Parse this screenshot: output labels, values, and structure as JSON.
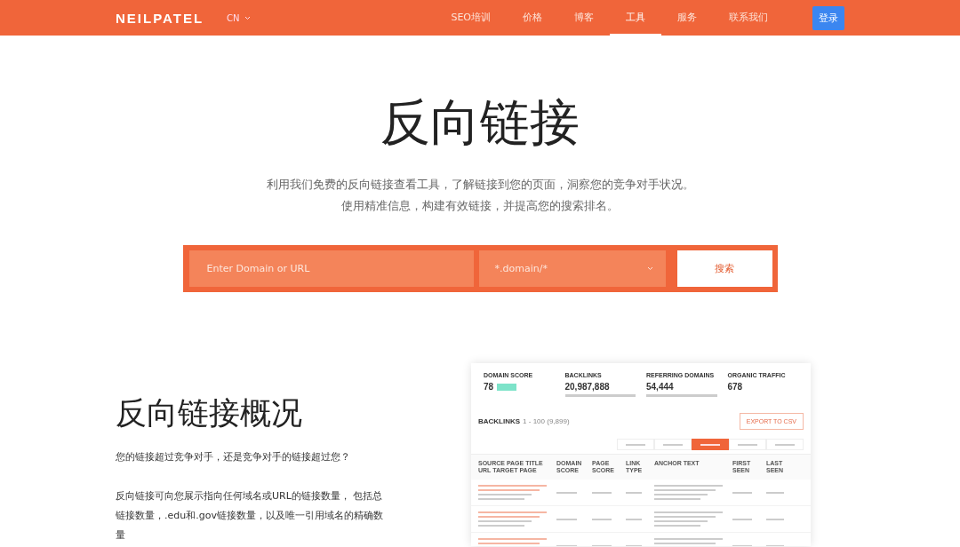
{
  "header": {
    "logo": "NEILPATEL",
    "language": "CN",
    "nav": [
      {
        "label": "SEO培训",
        "selected": false
      },
      {
        "label": "价格",
        "selected": false
      },
      {
        "label": "博客",
        "selected": false
      },
      {
        "label": "工具",
        "selected": true
      },
      {
        "label": "服务",
        "selected": false
      },
      {
        "label": "联系我们",
        "selected": false
      }
    ],
    "login": "登录"
  },
  "hero": {
    "title": "反向链接",
    "subtitle": [
      "利用我们免费的反向链接查看工具，了解链接到您的页面，洞察您的竞争对手状况。",
      "使用精准信息，构建有效链接，并提高您的搜索排名。"
    ]
  },
  "search": {
    "placeholder": "Enter Domain or URL",
    "mode": "*.domain/*",
    "button": "搜索"
  },
  "overview": {
    "title": "反向链接概况",
    "question": "您的链接超过竞争对手，还是竞争对手的链接超过您？",
    "paragraph": "反向链接可向您展示指向任何域名或URL的链接数量， 包括总链接数量，.edu和.gov链接数量，以及唯一引用域名的精确数量"
  },
  "preview": {
    "stats": [
      {
        "label": "DOMAIN SCORE",
        "value": "78",
        "badge": true
      },
      {
        "label": "BACKLINKS",
        "value": "20,987,888"
      },
      {
        "label": "REFERRING DOMAINS",
        "value": "54,444"
      },
      {
        "label": "ORGANIC TRAFFIC",
        "value": "678"
      }
    ],
    "list_title": "BACKLINKS",
    "list_range": "1 - 100 (9,899)",
    "export": "EXPORT TO CSV",
    "filters": [
      {
        "selected": false
      },
      {
        "selected": false
      },
      {
        "selected": true
      },
      {
        "selected": false
      },
      {
        "selected": false
      }
    ],
    "columns": [
      "SOURCE PAGE TITLE URL TARGET PAGE",
      "DOMAIN SCORE",
      "PAGE SCORE",
      "LINK TYPE",
      "ANCHOR TEXT",
      "FIRST SEEN",
      "LAST SEEN"
    ]
  }
}
